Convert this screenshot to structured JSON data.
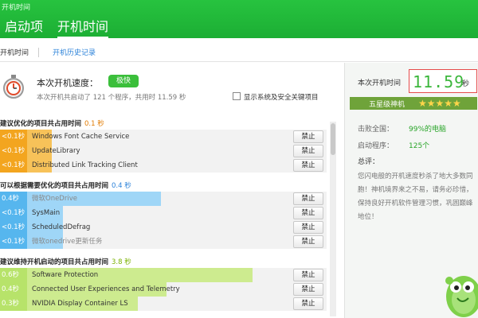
{
  "window": {
    "title": "开机时间"
  },
  "nav": {
    "tabs": [
      "启动项",
      "开机时间"
    ]
  },
  "subnav": {
    "tabs": [
      "开机时间",
      "开机历史记录"
    ]
  },
  "speed": {
    "title": "本次开机速度：",
    "badge": "极快",
    "desc": "本次开机共启动了 121 个程序，共用时 11.59 秒",
    "checkbox_label": "显示系统及安全关键项目"
  },
  "sections": [
    {
      "title": "建议优化的项目共占用时间",
      "time": "0.1 秒",
      "items": [
        {
          "tag": "<0.1秒",
          "name": "Windows Font Cache Service",
          "fill": 0.18
        },
        {
          "tag": "<0.1秒",
          "name": "UpdateLibrary",
          "fill": 0.18
        },
        {
          "tag": "<0.1秒",
          "name": "Distributed Link Tracking Client",
          "fill": 0.18
        }
      ]
    },
    {
      "title": "可以根据需要优化的项目共占用时间",
      "time": "0.4 秒",
      "items": [
        {
          "tag": "0.4秒",
          "name": "微软OneDrive",
          "fill": 0.56
        },
        {
          "tag": "<0.1秒",
          "name": "SysMain",
          "fill": 0.22
        },
        {
          "tag": "<0.1秒",
          "name": "ScheduledDefrag",
          "fill": 0.22
        },
        {
          "tag": "<0.1秒",
          "name": "微软onedrive更新任务",
          "fill": 0.22
        }
      ]
    },
    {
      "title": "建议维持开机启动的项目共占用时间",
      "time": "3.8 秒",
      "items": [
        {
          "tag": "0.6秒",
          "name": "Software Protection",
          "fill": 0.88
        },
        {
          "tag": "0.4秒",
          "name": "Connected User Experiences and Telemetry",
          "fill": 0.58
        },
        {
          "tag": "0.3秒",
          "name": "NVIDIA Display Container LS",
          "fill": 0.48
        }
      ]
    }
  ],
  "ban_label": "禁止",
  "right": {
    "time_label": "本次开机时间",
    "time_value": "11.59",
    "time_unit": "秒",
    "rank_label": "五星级神机",
    "stars": "★★★★★",
    "beat_label": "击败全国：",
    "beat_value": "99%的电脑",
    "programs_label": "启动程序：",
    "programs_value": "125个",
    "summary_title": "总评：",
    "summary_text": "您闪电般的开机速度秒杀了地大多数同胞！神机境界来之不易，请务必珍惜，保持良好开机软件管理习惯，巩固巅峰地位！"
  },
  "colors": {
    "header": "#22b83a",
    "orange": "#f3a51f",
    "blue": "#56b6ee",
    "lime": "#b7e36a"
  }
}
